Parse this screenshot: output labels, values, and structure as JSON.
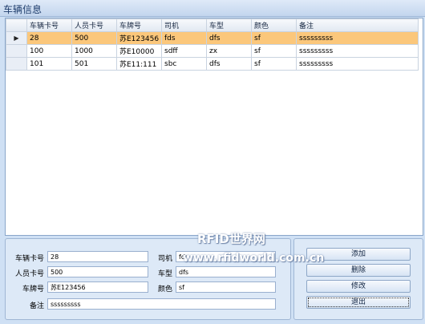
{
  "window": {
    "title": "车辆信息"
  },
  "grid": {
    "columns": [
      "车辆卡号",
      "人员卡号",
      "车牌号",
      "司机",
      "车型",
      "颜色",
      "备注"
    ],
    "rows": [
      [
        "28",
        "500",
        "苏E123456",
        "fds",
        "dfs",
        "sf",
        "sssssssss"
      ],
      [
        "100",
        "1000",
        "苏E10000",
        "sdff",
        "zx",
        "sf",
        "sssssssss"
      ],
      [
        "101",
        "501",
        "苏E11:111",
        "sbc",
        "dfs",
        "sf",
        "sssssssss"
      ]
    ],
    "selected_row": 0
  },
  "form": {
    "car_card_label": "车辆卡号",
    "car_card_value": "28",
    "person_card_label": "人员卡号",
    "person_card_value": "500",
    "plate_label": "车牌号",
    "plate_value": "苏E123456",
    "driver_label": "司机",
    "driver_value": "fds",
    "model_label": "车型",
    "model_value": "dfs",
    "color_label": "颜色",
    "color_value": "sf",
    "remark_label": "备注",
    "remark_value": "sssssssss"
  },
  "buttons": {
    "add": "添加",
    "delete": "删除",
    "edit": "修改",
    "exit": "退出"
  },
  "watermark": {
    "line1": "RFID世界网",
    "line2": "www.rfidworld.com.cn"
  }
}
